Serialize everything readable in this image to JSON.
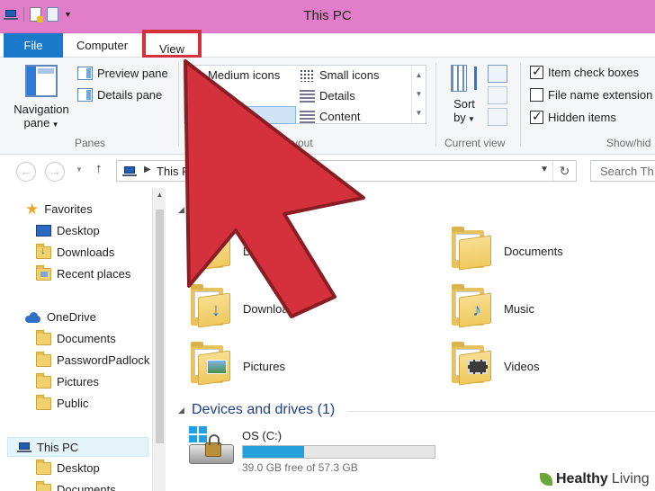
{
  "window": {
    "title": "This PC"
  },
  "ribbon": {
    "tabs": {
      "file": "File",
      "computer": "Computer",
      "view": "View"
    },
    "panes": {
      "group_label": "Panes",
      "navigation_pane_line1": "Navigation",
      "navigation_pane_line2": "pane",
      "preview_pane": "Preview pane",
      "details_pane": "Details pane"
    },
    "layout": {
      "group_label_visible": "yout",
      "medium_icons": "Medium icons",
      "small_icons": "Small icons",
      "details": "Details",
      "content": "Content"
    },
    "current_view": {
      "group_label": "Current view",
      "sort_by_line1": "Sort",
      "sort_by_line2": "by"
    },
    "show_hide": {
      "group_label": "Show/hid",
      "item_check_boxes": "Item check boxes",
      "item_check_boxes_checked": true,
      "file_name_extensions": "File name extension",
      "file_name_extensions_checked": false,
      "hidden_items": "Hidden items",
      "hidden_items_checked": true
    }
  },
  "address_bar": {
    "path": "This P",
    "search_placeholder": "Search Th"
  },
  "nav_tree": {
    "favorites": "Favorites",
    "desktop": "Desktop",
    "downloads": "Downloads",
    "recent_places": "Recent places",
    "onedrive": "OneDrive",
    "documents": "Documents",
    "passwordpadlock": "PasswordPadlock",
    "pictures": "Pictures",
    "public": "Public",
    "this_pc": "This PC",
    "pc_desktop": "Desktop",
    "pc_documents": "Documents"
  },
  "content": {
    "folders": {
      "desktop_partial": "Des",
      "downloads_partial": "Downloa",
      "pictures": "Pictures",
      "documents": "Documents",
      "music": "Music",
      "videos": "Videos"
    },
    "devices_header": "Devices and drives (1)",
    "drive": {
      "name": "OS (C:)",
      "free_text": "39.0 GB free of 57.3 GB",
      "used_fraction": 0.32
    }
  },
  "watermark": {
    "part1": "Healthy",
    "part2": "Living"
  },
  "colors": {
    "titlebar": "#e27ec9",
    "file_tab": "#1979ca",
    "highlight_red": "#d5313d",
    "progress": "#26a0da"
  }
}
